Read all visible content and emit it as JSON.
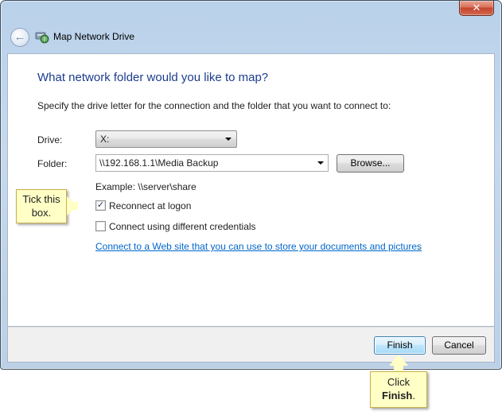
{
  "window": {
    "title": "Map Network Drive",
    "close_label": "✕",
    "back_label": "←"
  },
  "main": {
    "heading": "What network folder would you like to map?",
    "instruction": "Specify the drive letter for the connection and the folder that you want to connect to:",
    "drive_label": "Drive:",
    "drive_value": "X:",
    "folder_label": "Folder:",
    "folder_value": "\\\\192.168.1.1\\Media Backup",
    "browse_label": "Browse...",
    "example_text": "Example: \\\\server\\share",
    "reconnect_label": "Reconnect at logon",
    "reconnect_checked": true,
    "credentials_label": "Connect using different credentials",
    "credentials_checked": false,
    "web_link": "Connect to a Web site that you can use to store your documents and pictures",
    "web_link_tail": "."
  },
  "footer": {
    "finish_label": "Finish",
    "cancel_label": "Cancel"
  },
  "callouts": {
    "tick_line1": "Tick this",
    "tick_line2": "box.",
    "click_line1": "Click",
    "click_bold": "Finish",
    "click_tail": "."
  },
  "icons": {
    "back": "back-arrow-icon",
    "network_drive": "network-drive-icon",
    "checkmark": "checkmark-icon",
    "dropdown": "chevron-down-icon"
  },
  "colors": {
    "heading": "#1c3c8c",
    "link": "#0066cc",
    "callout_bg": "#ffffc6"
  }
}
